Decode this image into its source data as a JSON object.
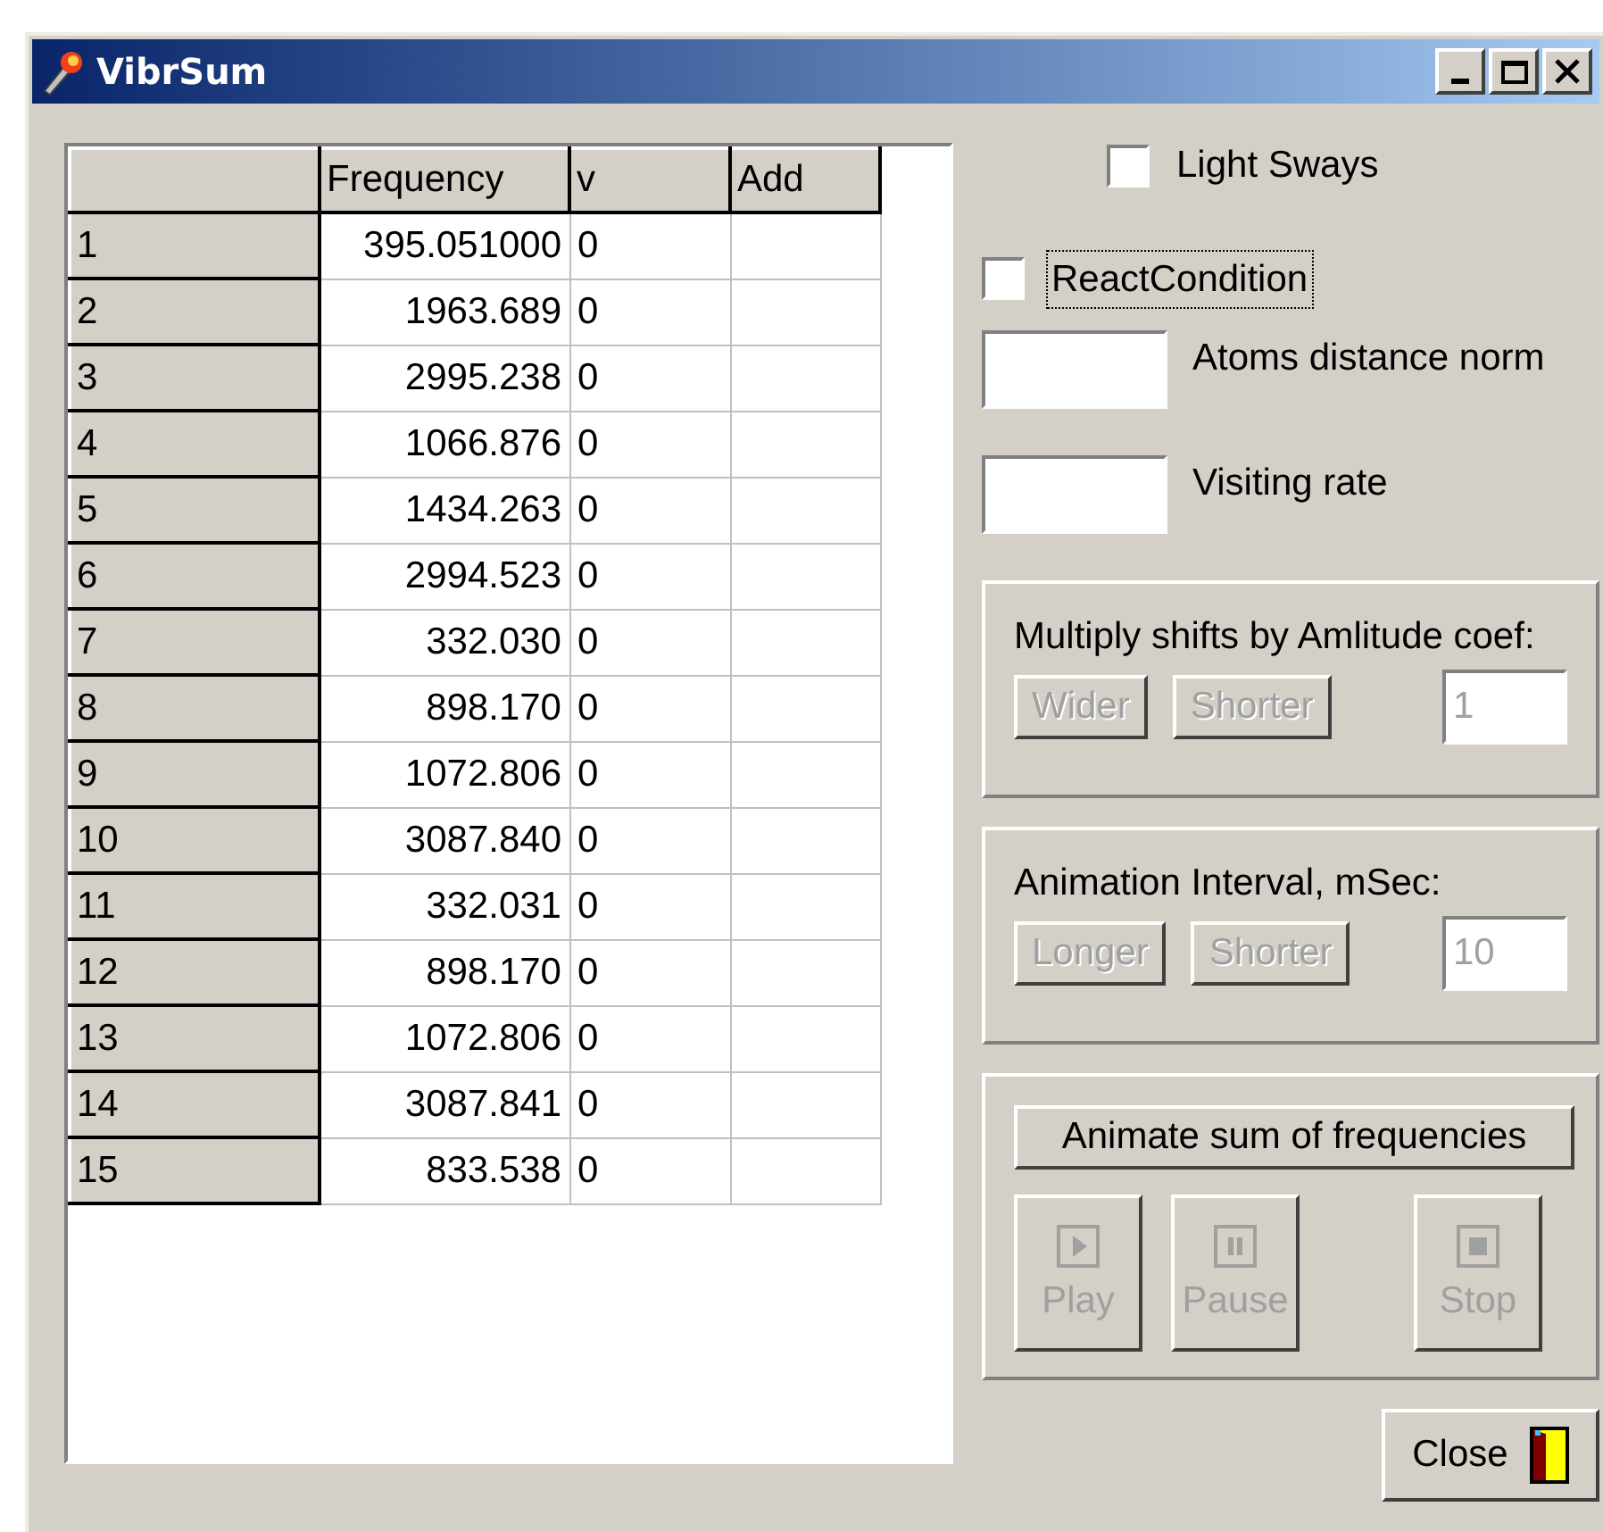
{
  "window": {
    "title": "VibrSum"
  },
  "table": {
    "columns": [
      "Frequency",
      "v",
      "Add"
    ],
    "rows": [
      {
        "header": "1",
        "frequency": "395.051000",
        "v": "0"
      },
      {
        "header": "2",
        "frequency": "1963.689",
        "v": "0"
      },
      {
        "header": "3",
        "frequency": "2995.238",
        "v": "0"
      },
      {
        "header": "4",
        "frequency": "1066.876",
        "v": "0"
      },
      {
        "header": "5",
        "frequency": "1434.263",
        "v": "0"
      },
      {
        "header": "6",
        "frequency": "2994.523",
        "v": "0"
      },
      {
        "header": "7",
        "frequency": "332.030",
        "v": "0"
      },
      {
        "header": "8",
        "frequency": "898.170",
        "v": "0"
      },
      {
        "header": "9",
        "frequency": "1072.806",
        "v": "0"
      },
      {
        "header": "10",
        "frequency": "3087.840",
        "v": "0"
      },
      {
        "header": "11",
        "frequency": "332.031",
        "v": "0"
      },
      {
        "header": "12",
        "frequency": "898.170",
        "v": "0"
      },
      {
        "header": "13",
        "frequency": "1072.806",
        "v": "0"
      },
      {
        "header": "14",
        "frequency": "3087.841",
        "v": "0"
      },
      {
        "header": "15",
        "frequency": "833.538",
        "v": "0"
      }
    ]
  },
  "checkboxes": [
    {
      "label": "Light Sways",
      "checked": false,
      "focused": false
    },
    {
      "label": "ReactCondition",
      "checked": false,
      "focused": true
    }
  ],
  "fields": [
    {
      "label": "Atoms distance norm"
    },
    {
      "label": "Visiting rate"
    }
  ],
  "amplitude_group": {
    "label": "Multiply shifts by Amlitude coef:",
    "buttons": [
      {
        "label": "Wider",
        "disabled": true
      },
      {
        "label": "Shorter",
        "disabled": true
      }
    ],
    "value": "1",
    "disabled": true
  },
  "interval_group": {
    "label": "Animation Interval, mSec:",
    "buttons": [
      {
        "label": "Longer",
        "disabled": true
      },
      {
        "label": "Shorter",
        "disabled": true
      }
    ],
    "value": "10",
    "disabled": true
  },
  "animate_group": {
    "button": {
      "label": "Animate sum of frequencies",
      "disabled": false
    },
    "controls": [
      {
        "kind": "play",
        "label": "Play",
        "disabled": true
      },
      {
        "kind": "pause",
        "label": "Pause",
        "disabled": true
      },
      {
        "kind": "stop",
        "label": "Stop",
        "disabled": true
      }
    ]
  },
  "close_button": {
    "label": "Close"
  }
}
